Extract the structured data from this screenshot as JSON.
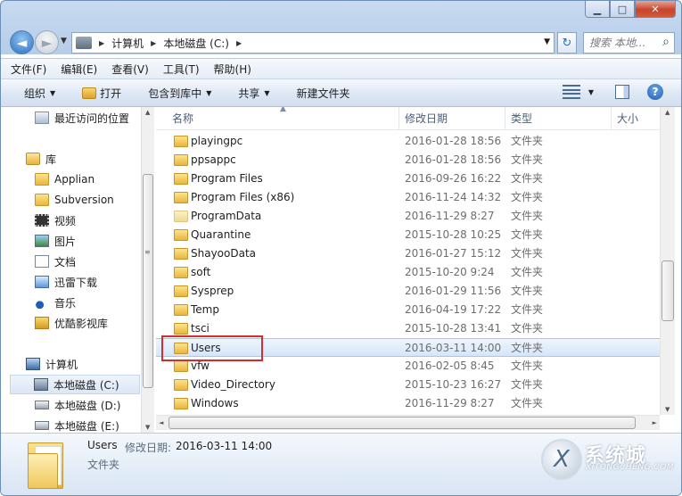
{
  "window": {
    "minimize_glyph": "▁",
    "maximize_glyph": "□",
    "close_glyph": "✕"
  },
  "nav": {
    "back_glyph": "◄",
    "forward_glyph": "►",
    "breadcrumbs": [
      "计算机",
      "本地磁盘 (C:)"
    ],
    "search_placeholder": "搜索 本地...",
    "refresh_glyph": "↻",
    "search_icon": "search-icon"
  },
  "menu": [
    "文件(F)",
    "编辑(E)",
    "查看(V)",
    "工具(T)",
    "帮助(H)"
  ],
  "toolbar": {
    "organize": "组织",
    "open": "打开",
    "include_in_library": "包含到库中",
    "share": "共享",
    "new_folder": "新建文件夹",
    "help_glyph": "?"
  },
  "navpane": {
    "recent": "最近访问的位置",
    "library": "库",
    "library_items": [
      "Applian",
      "Subversion",
      "视频",
      "图片",
      "文档",
      "迅雷下载",
      "音乐",
      "优酷影视库"
    ],
    "computer": "计算机",
    "drives": [
      "本地磁盘 (C:)",
      "本地磁盘 (D:)",
      "本地磁盘 (E:)"
    ],
    "selected_drive": "本地磁盘 (C:)"
  },
  "columns": [
    "名称",
    "修改日期",
    "类型",
    "大小"
  ],
  "files": [
    {
      "name": "playingpc",
      "date": "2016-01-28 18:56",
      "type": "文件夹"
    },
    {
      "name": "ppsappc",
      "date": "2016-01-28 18:56",
      "type": "文件夹"
    },
    {
      "name": "Program Files",
      "date": "2016-09-26 16:22",
      "type": "文件夹"
    },
    {
      "name": "Program Files (x86)",
      "date": "2016-11-24 14:32",
      "type": "文件夹"
    },
    {
      "name": "ProgramData",
      "date": "2016-11-29 8:27",
      "type": "文件夹"
    },
    {
      "name": "Quarantine",
      "date": "2015-10-28 10:25",
      "type": "文件夹"
    },
    {
      "name": "ShayooData",
      "date": "2016-01-27 15:12",
      "type": "文件夹"
    },
    {
      "name": "soft",
      "date": "2015-10-20 9:24",
      "type": "文件夹"
    },
    {
      "name": "Sysprep",
      "date": "2016-01-29 11:56",
      "type": "文件夹"
    },
    {
      "name": "Temp",
      "date": "2016-04-19 17:22",
      "type": "文件夹"
    },
    {
      "name": "tsci",
      "date": "2015-10-28 13:41",
      "type": "文件夹"
    },
    {
      "name": "Users",
      "date": "2016-03-11 14:00",
      "type": "文件夹"
    },
    {
      "name": "vfw",
      "date": "2016-02-05 8:45",
      "type": "文件夹"
    },
    {
      "name": "Video_Directory",
      "date": "2015-10-23 16:27",
      "type": "文件夹"
    },
    {
      "name": "Windows",
      "date": "2016-11-29 8:27",
      "type": "文件夹"
    }
  ],
  "selected_file": "Users",
  "details": {
    "name": "Users",
    "date_label": "修改日期:",
    "date": "2016-03-11 14:00",
    "type": "文件夹"
  },
  "watermark": {
    "text": "系统城",
    "url": "XITONGCHENG.COM"
  },
  "colors": {
    "highlight_box": "#d12f2f",
    "selection": "#d5e6fa",
    "accent": "#2a6fc0"
  }
}
